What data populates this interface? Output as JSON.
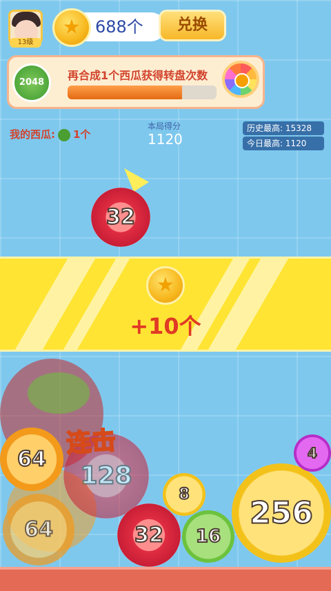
{
  "player": {
    "level": "13级",
    "coins": "688个",
    "exchange_label": "兑换"
  },
  "progress_panel": {
    "fruit_label": "2048",
    "title_text": "再合成1个西瓜获得转盘次数",
    "progress": 0.77
  },
  "stats": {
    "my_watermelon_label": "我的西瓜:",
    "my_watermelon_count": "1个",
    "score_label": "本局得分",
    "score_value": "1120",
    "history_best": "历史最高: 15328",
    "today_best": "今日最高: 1120"
  },
  "drop_fruit": {
    "value": "32"
  },
  "reward_banner": {
    "text": "+10个"
  },
  "combo_text": "连击",
  "fruits": [
    {
      "value": "64",
      "kind": "orange"
    },
    {
      "value": "128",
      "kind": "red"
    },
    {
      "value": "64",
      "kind": "orange"
    },
    {
      "value": "8",
      "kind": "yellow"
    },
    {
      "value": "32",
      "kind": "red"
    },
    {
      "value": "16",
      "kind": "green"
    },
    {
      "value": "256",
      "kind": "yellow"
    },
    {
      "value": "4",
      "kind": "purple"
    }
  ],
  "colors": {
    "background": "#7ec8ee",
    "banner": "#ffe433",
    "accent_red": "#d2432d",
    "floor": "#e46a55"
  }
}
